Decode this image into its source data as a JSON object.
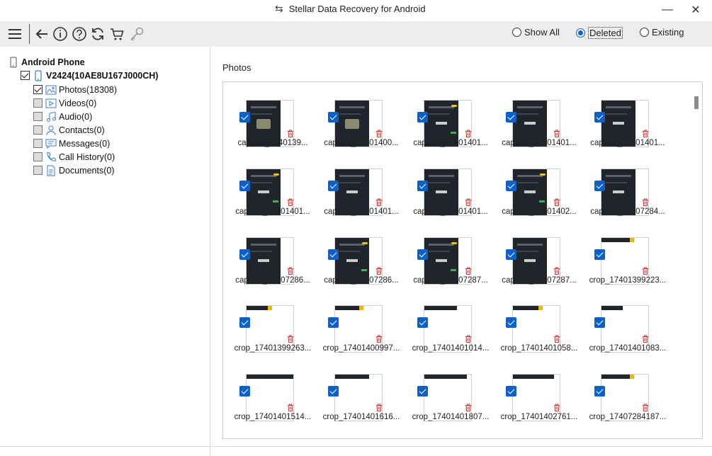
{
  "window": {
    "title": "Stellar Data Recovery for Android",
    "minimize": "—",
    "close": "✕"
  },
  "toolbar": {
    "tools": [
      "menu-icon",
      "back-icon",
      "info-icon",
      "help-icon",
      "refresh-icon",
      "cart-icon",
      "key-icon"
    ],
    "filters": [
      {
        "label": "Show All",
        "selected": false
      },
      {
        "label": "Deleted",
        "selected": true
      },
      {
        "label": "Existing",
        "selected": false
      }
    ]
  },
  "tree": {
    "root": "Android Phone",
    "device": "V2424(10AE8U167J000CH)",
    "items": [
      {
        "label": "Photos(18308)",
        "checked": true,
        "icon": "photo-icon"
      },
      {
        "label": "Videos(0)",
        "checked": false,
        "icon": "video-icon"
      },
      {
        "label": "Audio(0)",
        "checked": false,
        "icon": "audio-icon"
      },
      {
        "label": "Contacts(0)",
        "checked": false,
        "icon": "contact-icon"
      },
      {
        "label": "Messages(0)",
        "checked": false,
        "icon": "message-icon"
      },
      {
        "label": "Call History(0)",
        "checked": false,
        "icon": "call-icon"
      },
      {
        "label": "Documents(0)",
        "checked": false,
        "icon": "document-icon"
      }
    ]
  },
  "main": {
    "section_title": "Photos",
    "photos": [
      {
        "name": "capture_1740139...",
        "style": "dark"
      },
      {
        "name": "capture_17401400...",
        "style": "dark"
      },
      {
        "name": "capture_17401401...",
        "style": "dark"
      },
      {
        "name": "capture_17401401...",
        "style": "dark"
      },
      {
        "name": "capture_17401401...",
        "style": "dark"
      },
      {
        "name": "capture_17401401...",
        "style": "dark"
      },
      {
        "name": "capture_17401401...",
        "style": "dark"
      },
      {
        "name": "capture_17401401...",
        "style": "dark"
      },
      {
        "name": "capture_17401402...",
        "style": "dark"
      },
      {
        "name": "capture_17407284...",
        "style": "dark"
      },
      {
        "name": "capture_17407286...",
        "style": "dark"
      },
      {
        "name": "capture_17407286...",
        "style": "dark"
      },
      {
        "name": "capture_17407287...",
        "style": "dark"
      },
      {
        "name": "capture_17407287...",
        "style": "dark"
      },
      {
        "name": "crop_17401399223...",
        "style": "crop"
      },
      {
        "name": "crop_17401399263...",
        "style": "crop"
      },
      {
        "name": "crop_17401400997...",
        "style": "crop"
      },
      {
        "name": "crop_17401401014...",
        "style": "crop"
      },
      {
        "name": "crop_17401401058...",
        "style": "crop"
      },
      {
        "name": "crop_17401401083...",
        "style": "crop"
      },
      {
        "name": "crop_17401401514...",
        "style": "crop"
      },
      {
        "name": "crop_17401401616...",
        "style": "crop"
      },
      {
        "name": "crop_17401401807...",
        "style": "crop"
      },
      {
        "name": "crop_17401402761...",
        "style": "crop"
      },
      {
        "name": "crop_17407284187...",
        "style": "crop"
      }
    ]
  },
  "colors": {
    "accent": "#0a61c9",
    "toolbar_bg": "#eceded",
    "delete_red": "#d9302c"
  }
}
